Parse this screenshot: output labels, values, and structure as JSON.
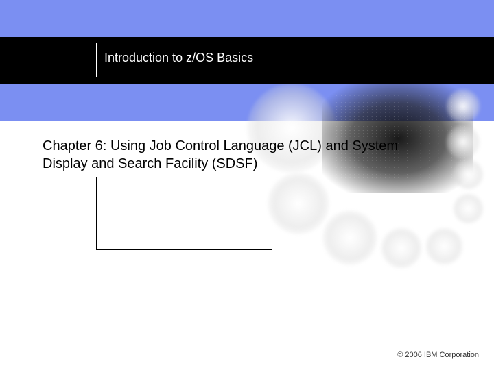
{
  "course_title": "Introduction to z/OS Basics",
  "chapter_title": "Chapter 6:  Using Job Control Language (JCL) and System Display and Search Facility (SDSF)",
  "footer": "© 2006 IBM Corporation"
}
